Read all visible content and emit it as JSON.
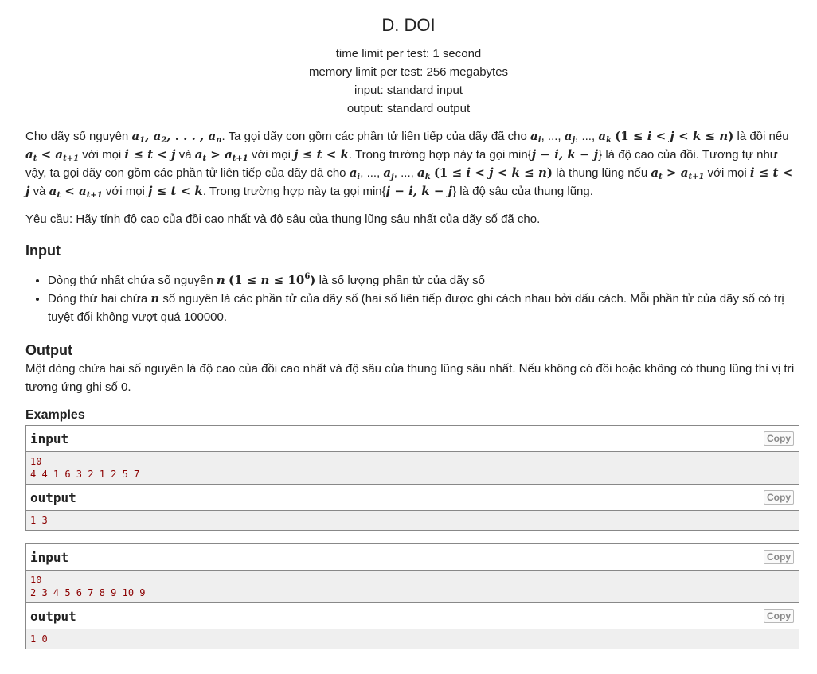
{
  "problem": {
    "title": "D. DOI",
    "time_limit": "time limit per test: 1 second",
    "memory_limit": "memory limit per test: 256 megabytes",
    "input_file": "input: standard input",
    "output_file": "output: standard output"
  },
  "statement": {
    "p1_a": "Cho dãy số nguyên",
    "p1_b": ". Ta gọi dãy con gồm các phần tử liên tiếp của dãy đã cho",
    "p1_c": "là đồi nếu",
    "p1_d": "với mọi",
    "p1_e": "và",
    "p1_f": "với mọi",
    "p1_g": ". Trong trường hợp này ta gọi min{",
    "p1_h": "} là độ cao của đồi.",
    "p2_a": "Tương tự như vậy, ta gọi dãy con gồm các phần tử liên tiếp của dãy đã cho",
    "p2_b": "là thung lũng nếu",
    "p2_c": "với mọi",
    "p2_d": "và",
    "p2_e": "với mọi",
    "p2_f": ". Trong trường hợp này ta gọi min{",
    "p2_g": "} là độ sâu của thung lũng.",
    "request": "Yêu cầu: Hãy tính độ cao của đồi cao nhất và độ sâu của thung lũng sâu nhất của dãy số đã cho."
  },
  "input_section": {
    "title": "Input",
    "li1_a": "Dòng thứ nhất chứa số nguyên",
    "li1_b": "là số lượng phần tử của dãy số",
    "li2_a": "Dòng thứ hai chứa",
    "li2_b": "số nguyên là các phần tử của dãy số (hai số liên tiếp được ghi cách nhau bởi dấu cách. Mỗi phần tử của dãy số có trị tuyệt đối không vượt quá 100000."
  },
  "output_section": {
    "title": "Output",
    "text": "Một dòng chứa hai số nguyên là độ cao của đồi cao nhất và độ sâu của thung lũng sâu nhất. Nếu không có đồi hoặc không có thung lũng thì vị trí tương ứng ghi số 0."
  },
  "examples": {
    "title": "Examples",
    "input_label": "input",
    "output_label": "output",
    "copy_label": "Copy",
    "ex1_input": "10\n4 4 1 6 3 2 1 2 5 7",
    "ex1_output": "1 3",
    "ex2_input": "10\n2 3 4 5 6 7 8 9 10 9",
    "ex2_output": "1 0"
  }
}
